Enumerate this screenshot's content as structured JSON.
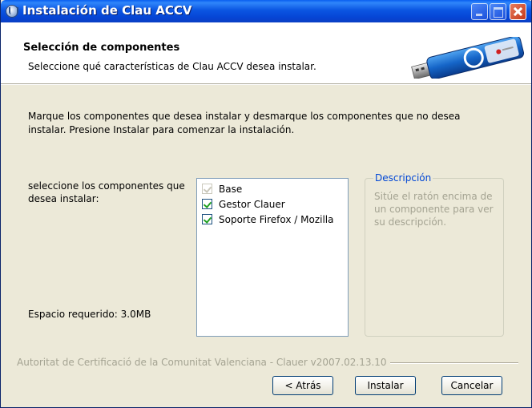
{
  "window": {
    "title": "Instalación de Clau ACCV"
  },
  "header": {
    "title": "Selección de componentes",
    "subtitle": "Seleccione qué características de Clau ACCV desea instalar."
  },
  "intro": "Marque los componentes que desea instalar y desmarque los componentes que no desea instalar. Presione Instalar para comenzar la instalación.",
  "left_label": "seleccione los componentes que desea instalar:",
  "space_required": "Espacio requerido: 3.0MB",
  "components": [
    {
      "label": "Base",
      "checked": true,
      "enabled": false
    },
    {
      "label": "Gestor Clauer",
      "checked": true,
      "enabled": true
    },
    {
      "label": "Soporte Firefox / Mozilla",
      "checked": true,
      "enabled": true
    }
  ],
  "description": {
    "legend": "Descripción",
    "text": "Sitúe el ratón encima de un componente para ver su descripción."
  },
  "footer": "Autoritat de Certificació de la Comunitat Valenciana - Clauer v2007.02.13.10",
  "buttons": {
    "back": "< Atrás",
    "install": "Instalar",
    "cancel": "Cancelar"
  },
  "icons": [
    "setup-icon",
    "minimize-icon",
    "maximize-icon",
    "close-icon",
    "usb-key-icon",
    "checkbox-icon"
  ],
  "colors": {
    "title_bar": "#0b56e2",
    "dialog": "#ece9d8",
    "legend": "#0046d5",
    "disabled_text": "#a4a392",
    "check": "#21a121"
  }
}
